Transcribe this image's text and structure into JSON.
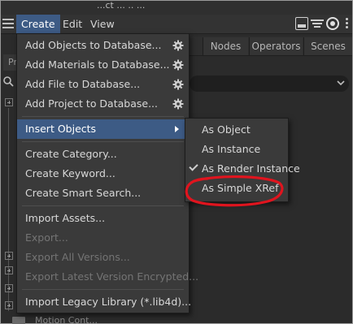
{
  "window": {
    "title_fragment": "...ct ... .. ..."
  },
  "menubar": {
    "items": [
      "Create",
      "Edit",
      "View"
    ]
  },
  "tabs": [
    "Nodes",
    "Operators",
    "Scenes"
  ],
  "left_panel": {
    "tab_fragment": "Pr",
    "bottom_label_fragment": "Motion Cont..."
  },
  "create_menu": {
    "items": [
      {
        "label": "Add Objects to Database...",
        "icon": "gear-icon"
      },
      {
        "label": "Add Materials to Database...",
        "icon": "gear-icon"
      },
      {
        "label": "Add File to Database...",
        "icon": "gear-icon"
      },
      {
        "label": "Add Project to Database...",
        "icon": "gear-icon"
      },
      {
        "label": "Insert Objects",
        "state": "active"
      },
      {
        "label": "Create Category..."
      },
      {
        "label": "Create Keyword..."
      },
      {
        "label": "Create Smart Search..."
      },
      {
        "label": "Import Assets..."
      },
      {
        "label": "Export...",
        "state": "disabled"
      },
      {
        "label": "Export All Versions...",
        "state": "disabled"
      },
      {
        "label": "Export Latest Version Encrypted...",
        "state": "disabled"
      },
      {
        "label": "Import Legacy Library (*.lib4d)..."
      }
    ]
  },
  "insert_submenu": {
    "items": [
      {
        "label": "As Object"
      },
      {
        "label": "As Instance"
      },
      {
        "label": "As Render Instance",
        "checked": true
      },
      {
        "label": "As Simple XRef",
        "highlighted_by_annotation": true
      }
    ]
  },
  "annotation": {
    "color": "#e0141e",
    "shape": "hand-drawn-ellipse"
  },
  "colors": {
    "accent": "#3d5b85",
    "menu_bg": "#3a3a3a",
    "app_bg": "#2b2b2b"
  }
}
